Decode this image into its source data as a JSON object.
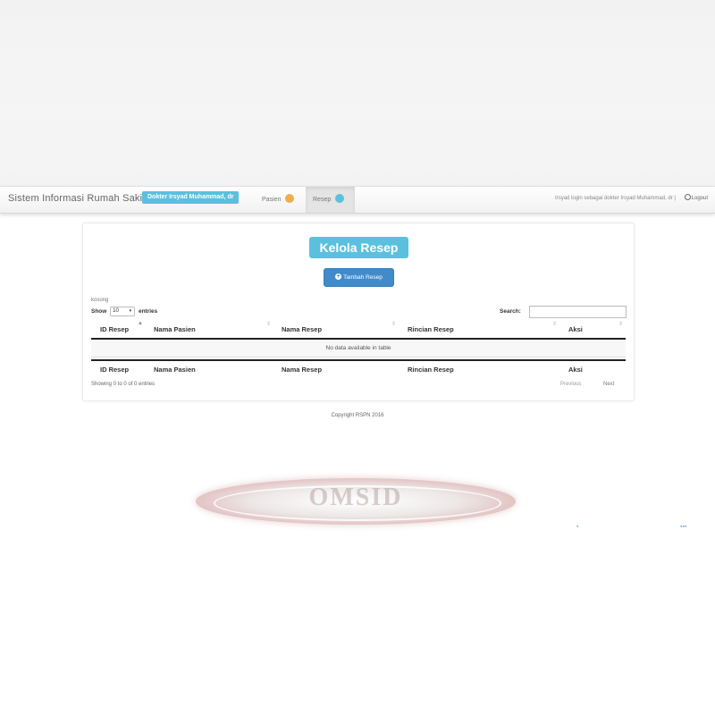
{
  "navbar": {
    "brand": "Sistem Informasi Rumah Sakit",
    "user_badge": "Dokter Irsyad Muhammad, dr",
    "tabs": [
      {
        "label": "Pasien",
        "badge_color": "#f0ad4e"
      },
      {
        "label": "Resep",
        "badge_color": "#5bc0de"
      }
    ],
    "login_info": "Irsyad login sebagai dokter Irsyad Muhammad, dr |",
    "logout_label": "Logout"
  },
  "main": {
    "title": "Kelola Resep",
    "add_button": "Tambah Resep",
    "empty_label": "kosong",
    "length": {
      "show": "Show",
      "value": "10",
      "entries": "entries"
    },
    "search_label": "Search:",
    "search_value": "",
    "columns": [
      "ID Resep",
      "Nama Pasien",
      "Nama Resep",
      "Rincian Resep",
      "Aksi"
    ],
    "empty_message": "No data available in table",
    "info": "Showing 0 to 0 of 0 entries",
    "pagination": {
      "previous": "Previous",
      "next": "Next"
    }
  },
  "footer": {
    "copyright": "Copyright RSPN 2016"
  },
  "watermark": {
    "text": "OMSID"
  },
  "colors": {
    "info": "#5bc0de",
    "primary": "#428bca",
    "warning": "#f0ad4e"
  }
}
